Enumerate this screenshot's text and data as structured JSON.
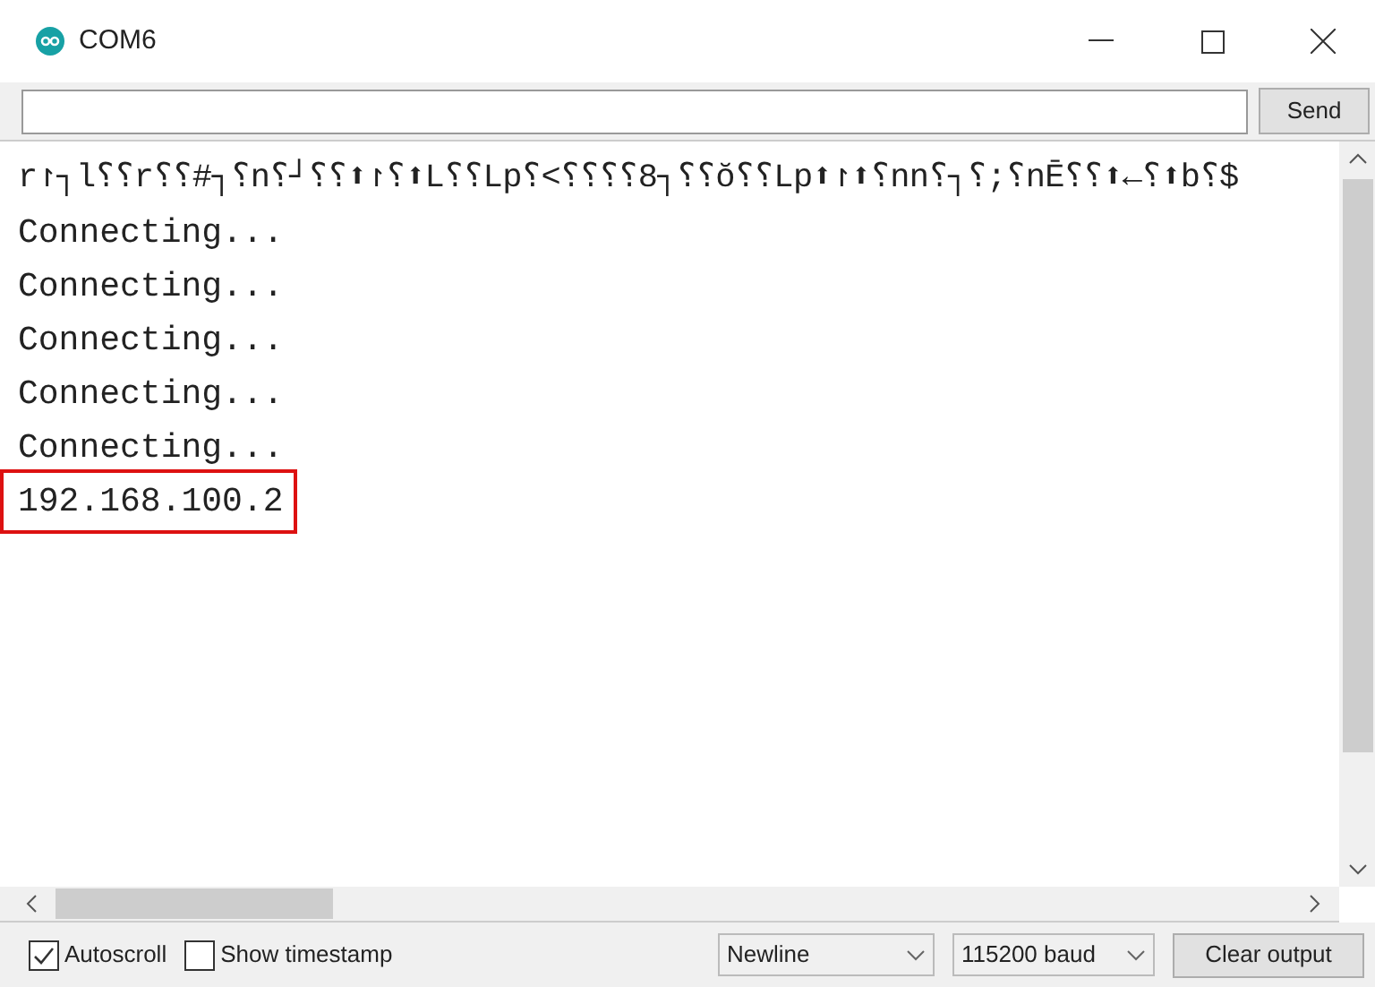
{
  "window": {
    "title": "COM6"
  },
  "send_button": "Send",
  "output_lines": [
    {
      "text": "r↾┐l⸮⸮r⸮⸮#┐⸮n⸮┘⸮⸮⬆↾⸮⬆L⸮⸮Lp⸮<⸮⸮⸮⸮8┐⸮⸮ŏ⸮⸮Lp⬆↾⬆⸮nn⸮┐⸮;⸮nĒ⸮⸮⬆←⸮⬆b⸮$",
      "highlighted": false
    },
    {
      "text": "Connecting...",
      "highlighted": false
    },
    {
      "text": "Connecting...",
      "highlighted": false
    },
    {
      "text": "Connecting...",
      "highlighted": false
    },
    {
      "text": "Connecting...",
      "highlighted": false
    },
    {
      "text": "Connecting...",
      "highlighted": false
    },
    {
      "text": "192.168.100.2",
      "highlighted": true
    }
  ],
  "autoscroll": {
    "label": "Autoscroll",
    "checked": true
  },
  "show_timestamp": {
    "label": "Show timestamp",
    "checked": false
  },
  "line_ending": "Newline",
  "baud_rate": "115200 baud",
  "clear_button": "Clear output"
}
